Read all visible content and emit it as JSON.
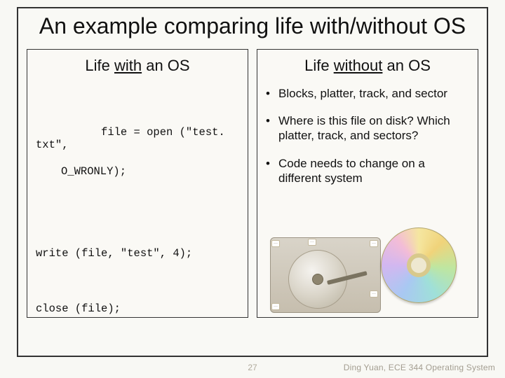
{
  "title": "An example comparing life with/without OS",
  "left": {
    "heading_pre": "Life ",
    "heading_u": "with",
    "heading_post": " an OS",
    "code_line1a": "file = open (\"test. txt\",",
    "code_line1b": "O_WRONLY);",
    "code_line2": "write (file, \"test\", 4);",
    "code_line3": "close (file);"
  },
  "right": {
    "heading_pre": "Life ",
    "heading_u": "without",
    "heading_post": " an OS",
    "bullets": [
      "Blocks, platter, track, and sector",
      "Where is this file on disk? Which platter, track, and sectors?",
      "Code needs to change on a different system"
    ]
  },
  "footer": {
    "page": "27",
    "credit": "Ding Yuan, ECE 344 Operating System"
  }
}
